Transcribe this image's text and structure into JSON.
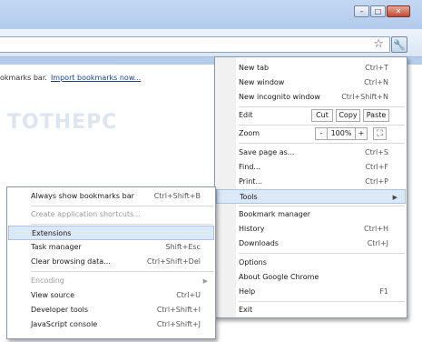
{
  "window": {
    "minimize": "–",
    "maximize": "□",
    "close": "✕"
  },
  "toolbar": {
    "star_icon": "star-icon",
    "wrench_icon": "wrench-icon"
  },
  "bookmarks_bar": {
    "text": "okmarks bar.",
    "link": "Import bookmarks now..."
  },
  "page": {
    "logo": "TOTHEPC"
  },
  "main_menu": {
    "new_tab": {
      "label": "New tab",
      "shortcut": "Ctrl+T"
    },
    "new_window": {
      "label": "New window",
      "shortcut": "Ctrl+N"
    },
    "new_incognito": {
      "label": "New incognito window",
      "shortcut": "Ctrl+Shift+N"
    },
    "edit": {
      "label": "Edit",
      "cut": "Cut",
      "copy": "Copy",
      "paste": "Paste"
    },
    "zoom": {
      "label": "Zoom",
      "minus": "-",
      "value": "100%",
      "plus": "+"
    },
    "save_page": {
      "label": "Save page as...",
      "shortcut": "Ctrl+S"
    },
    "find": {
      "label": "Find...",
      "shortcut": "Ctrl+F"
    },
    "print": {
      "label": "Print...",
      "shortcut": "Ctrl+P"
    },
    "tools": {
      "label": "Tools"
    },
    "bookmark_manager": {
      "label": "Bookmark manager"
    },
    "history": {
      "label": "History",
      "shortcut": "Ctrl+H"
    },
    "downloads": {
      "label": "Downloads",
      "shortcut": "Ctrl+J"
    },
    "options": {
      "label": "Options"
    },
    "about": {
      "label": "About Google Chrome"
    },
    "help": {
      "label": "Help",
      "shortcut": "F1"
    },
    "exit": {
      "label": "Exit"
    }
  },
  "tools_menu": {
    "always_show_bookmarks": {
      "label": "Always show bookmarks bar",
      "shortcut": "Ctrl+Shift+B"
    },
    "app_shortcuts": {
      "label": "Create application shortcuts..."
    },
    "extensions": {
      "label": "Extensions"
    },
    "task_manager": {
      "label": "Task manager",
      "shortcut": "Shift+Esc"
    },
    "clear_browsing": {
      "label": "Clear browsing data...",
      "shortcut": "Ctrl+Shift+Del"
    },
    "encoding": {
      "label": "Encoding"
    },
    "view_source": {
      "label": "View source",
      "shortcut": "Ctrl+U"
    },
    "developer_tools": {
      "label": "Developer tools",
      "shortcut": "Ctrl+Shift+I"
    },
    "js_console": {
      "label": "JavaScript console",
      "shortcut": "Ctrl+Shift+J"
    }
  }
}
